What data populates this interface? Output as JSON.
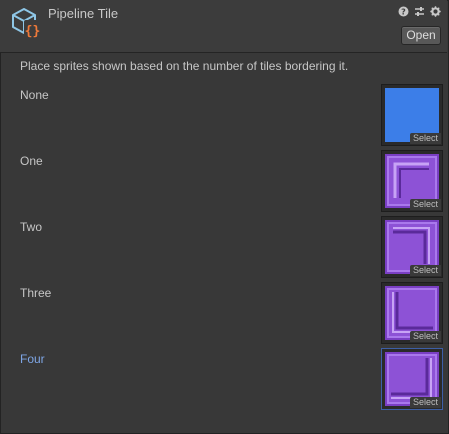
{
  "header": {
    "title": "Pipeline Tile",
    "open_label": "Open",
    "icons": [
      "help-icon",
      "preset-sliders-icon",
      "settings-gear-icon"
    ]
  },
  "description": "Place sprites shown based on the number of tiles bordering it.",
  "rows": [
    {
      "label": "None",
      "select_label": "Select",
      "sprite": "blue-square",
      "color": "#3c7ee8"
    },
    {
      "label": "One",
      "select_label": "Select",
      "sprite": "purple-corner-tile",
      "color": "#8a4fd0"
    },
    {
      "label": "Two",
      "select_label": "Select",
      "sprite": "purple-corner-tile",
      "color": "#8a4fd0"
    },
    {
      "label": "Three",
      "select_label": "Select",
      "sprite": "purple-corner-tile",
      "color": "#8a4fd0"
    },
    {
      "label": "Four",
      "select_label": "Select",
      "sprite": "purple-corner-tile",
      "color": "#8a4fd0",
      "active": true
    }
  ],
  "colors": {
    "active_label": "#7ea6e6",
    "panel_bg": "#383838",
    "header_bg": "#3c3c3c"
  }
}
